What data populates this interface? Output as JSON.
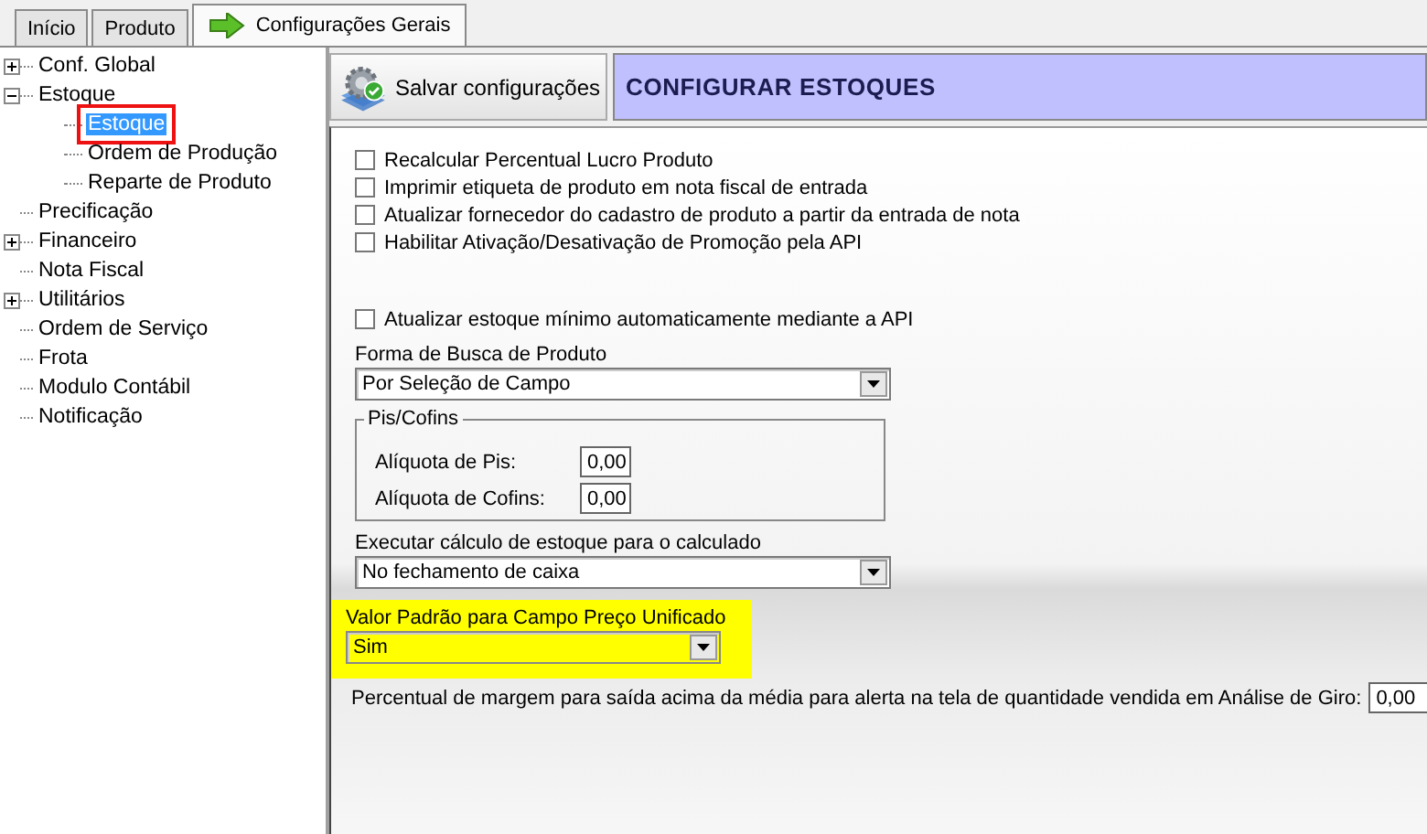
{
  "tabs": [
    {
      "label": "Início",
      "selected": false,
      "icon": false
    },
    {
      "label": "Produto",
      "selected": false,
      "icon": false
    },
    {
      "label": "Configurações Gerais",
      "selected": true,
      "icon": true
    }
  ],
  "tree": {
    "items": [
      {
        "label": "Conf. Global",
        "expanded": false,
        "selected": false,
        "outlined": false
      },
      {
        "label": "Estoque",
        "expanded": true,
        "selected": false,
        "outlined": false,
        "children": [
          {
            "label": "Estoque",
            "selected": true,
            "outlined": true
          },
          {
            "label": "Ordem de Produção",
            "selected": false,
            "outlined": false
          },
          {
            "label": "Reparte de Produto",
            "selected": false,
            "outlined": false
          }
        ]
      },
      {
        "label": "Precificação",
        "selected": false,
        "outlined": false
      },
      {
        "label": "Financeiro",
        "expanded": false,
        "selected": false,
        "outlined": false
      },
      {
        "label": "Nota Fiscal",
        "selected": false,
        "outlined": false
      },
      {
        "label": "Utilitários",
        "expanded": false,
        "selected": false,
        "outlined": false
      },
      {
        "label": "Ordem de Serviço",
        "selected": false,
        "outlined": false
      },
      {
        "label": "Frota",
        "selected": false,
        "outlined": false
      },
      {
        "label": "Modulo Contábil",
        "selected": false,
        "outlined": false
      },
      {
        "label": "Notificação",
        "selected": false,
        "outlined": false
      }
    ]
  },
  "toolbar": {
    "save_button": "Salvar configurações",
    "header": "CONFIGURAR ESTOQUES"
  },
  "checkboxes": [
    {
      "label": "Recalcular Percentual Lucro Produto",
      "checked": false
    },
    {
      "label": "Imprimir etiqueta de produto em nota fiscal de entrada",
      "checked": false
    },
    {
      "label": "Atualizar fornecedor do cadastro de produto a partir da entrada de nota",
      "checked": false
    },
    {
      "label": "Habilitar Ativação/Desativação de Promoção pela API",
      "checked": false
    }
  ],
  "options": [
    {
      "kind": "checkbox",
      "label": "Atualizar estoque mínimo automaticamente mediante a API",
      "checked": false
    },
    {
      "kind": "select",
      "label": "Forma de Busca de Produto",
      "value": "Por Seleção de Campo",
      "highlighted": false
    },
    {
      "kind": "group",
      "label": "Pis/Cofins",
      "fields": [
        {
          "label": "Alíquota de Pis:",
          "value": "0,00"
        },
        {
          "label": "Alíquota de Cofins:",
          "value": "0,00"
        }
      ]
    },
    {
      "kind": "select",
      "label": "Executar cálculo de estoque para o calculado",
      "value": "No fechamento de caixa",
      "highlighted": false
    },
    {
      "kind": "select",
      "label": "Valor Padrão para Campo Preço Unificado",
      "value": "Sim",
      "highlighted": true
    },
    {
      "kind": "field",
      "label": "Percentual de margem para saída acima da média para alerta na tela de quantidade vendida em Análise de Giro:",
      "value": "0,00"
    }
  ]
}
